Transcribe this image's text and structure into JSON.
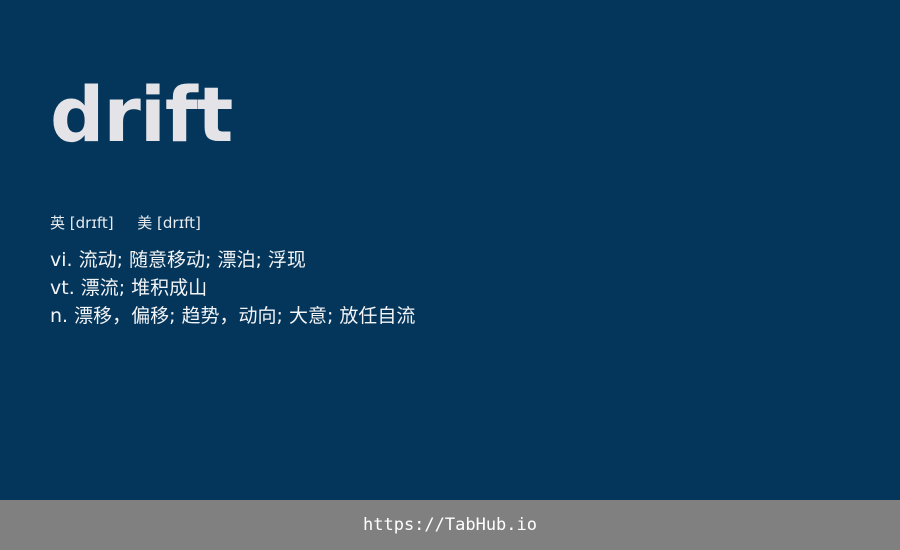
{
  "word": "drift",
  "phonetics": {
    "uk_label": "英",
    "uk_ipa": "[drɪft]",
    "us_label": "美",
    "us_ipa": "[drɪft]"
  },
  "definitions": [
    {
      "pos": "vi.",
      "meaning": "流动; 随意移动; 漂泊; 浮现"
    },
    {
      "pos": "vt.",
      "meaning": "漂流; 堆积成山"
    },
    {
      "pos": "n.",
      "meaning": "漂移，偏移; 趋势，动向; 大意; 放任自流"
    }
  ],
  "footer": {
    "link": "https://TabHub.io"
  },
  "colors": {
    "background": "#04355a",
    "footer_bg": "#808080",
    "word": "#e4e4e8",
    "text": "#f2f4f6"
  }
}
